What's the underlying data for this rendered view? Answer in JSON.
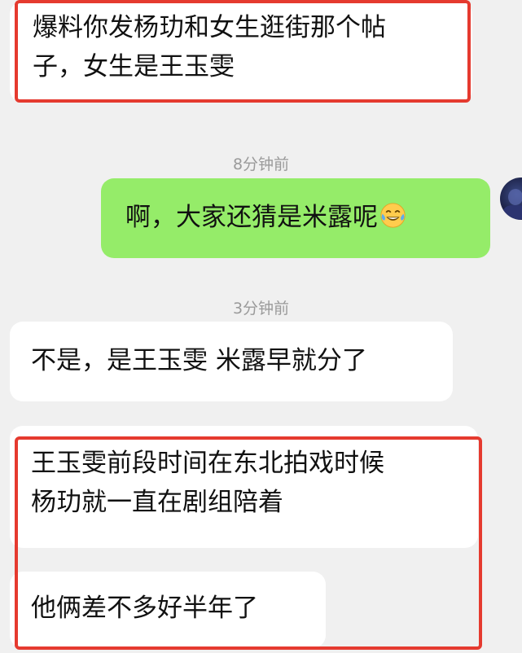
{
  "messages": [
    {
      "lines": [
        "爆料你发杨玏和女生逛街那个帖",
        "子，女生是王玉雯"
      ]
    },
    {
      "time": "8分钟前"
    },
    {
      "text": "啊，大家还猜是米露呢",
      "emoji": "tears-of-joy-emoji"
    },
    {
      "time": "3分钟前"
    },
    {
      "text": "不是，是王玉雯 米露早就分了"
    },
    {
      "lines": [
        "王玉雯前段时间在东北拍戏时候",
        "杨玏就一直在剧组陪着"
      ]
    },
    {
      "text": "他俩差不多好半年了"
    }
  ],
  "colors": {
    "incoming_bubble": "#ffffff",
    "outgoing_bubble": "#95ec69",
    "highlight": "#e53a2f",
    "background": "#f0f0f0"
  }
}
